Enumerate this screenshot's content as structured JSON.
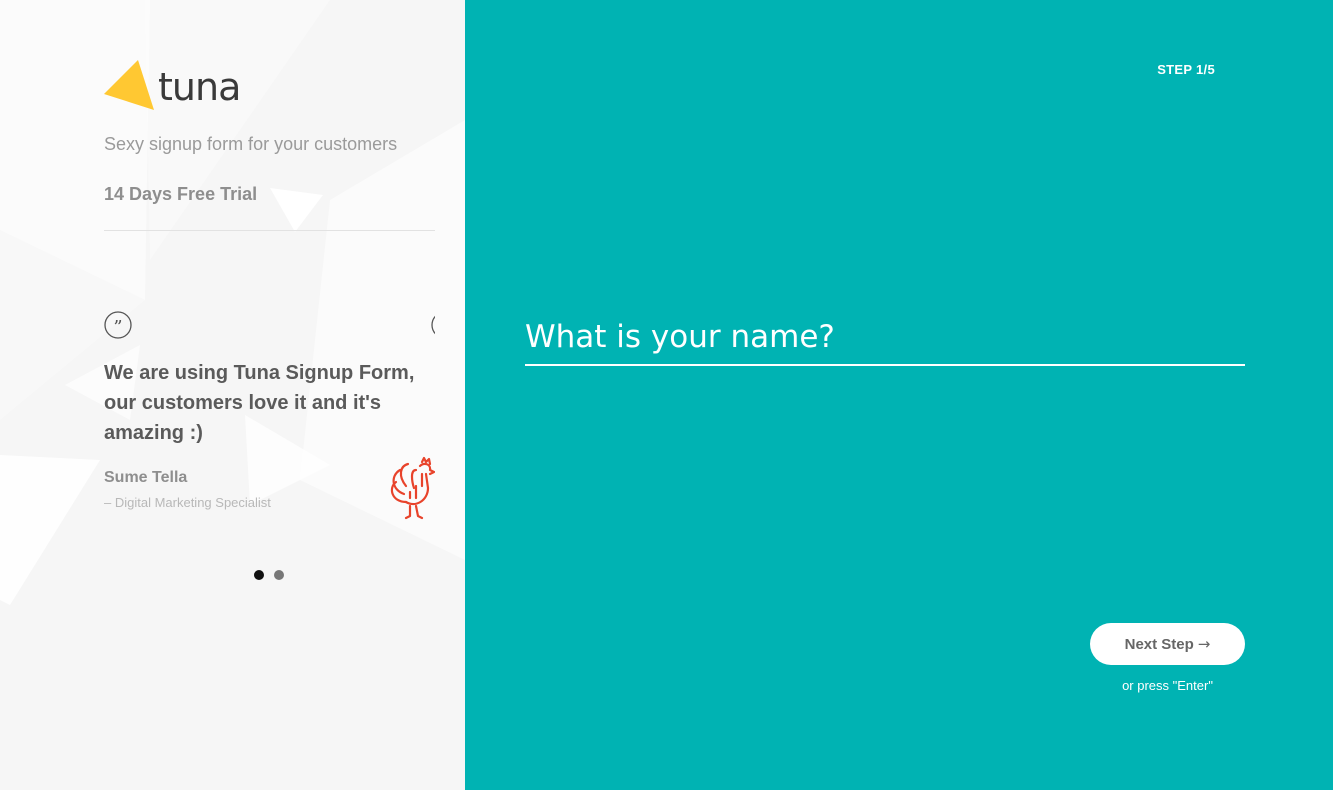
{
  "brand": {
    "name": "tuna",
    "tagline": "Sexy signup form for your customers",
    "trial": "14 Days Free Trial",
    "accent_color": "#ffc832"
  },
  "testimonial": {
    "quote": "We are using Tuna Signup Form, our customers love it and it's amazing :)",
    "author": "Sume Tella",
    "role": "– Digital Marketing Specialist",
    "slides_total": 2,
    "active_slide": 1
  },
  "form": {
    "step": "STEP 1/5",
    "name_placeholder": "What is your name?",
    "name_value": "",
    "next_button": "Next Step",
    "next_arrow": "→",
    "hint": "or press \"Enter\""
  },
  "colors": {
    "left_background": "#f6f6f6",
    "right_background": "#00b3b3",
    "rooster_icon": "#e8432b"
  },
  "icons": {
    "quote": "quote-icon",
    "rooster": "rooster-icon"
  }
}
